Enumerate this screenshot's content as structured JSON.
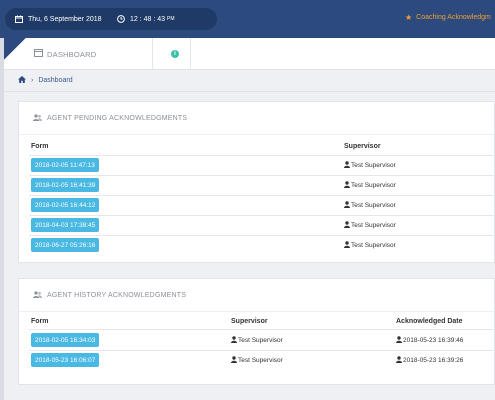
{
  "topbar": {
    "date": "Thu, 6 September 2018",
    "time": "12 : 48 : 43",
    "ampm": "PM",
    "coaching_link": "Coaching Acknowledgm"
  },
  "header": {
    "dashboard_tab": "DASHBOARD",
    "info_icon": "i"
  },
  "breadcrumb": {
    "home_icon": "home-icon",
    "current": "Dashboard"
  },
  "pending": {
    "title": "AGENT PENDING ACKNOWLEDGMENTS",
    "columns": [
      "Form",
      "Supervisor"
    ],
    "rows": [
      {
        "form": "2018-02-05 11:47:13",
        "supervisor": "Test Supervisor"
      },
      {
        "form": "2018-02-05 16:41:39",
        "supervisor": "Test Supervisor"
      },
      {
        "form": "2018-02-05 16:44:12",
        "supervisor": "Test Supervisor"
      },
      {
        "form": "2018-04-03 17:38:45",
        "supervisor": "Test Supervisor"
      },
      {
        "form": "2018-06-27 05:26:16",
        "supervisor": "Test Supervisor"
      }
    ]
  },
  "history": {
    "title": "AGENT HISTORY ACKNOWLEDGMENTS",
    "columns": [
      "Form",
      "Supervisor",
      "Acknowledged Date"
    ],
    "rows": [
      {
        "form": "2018-02-05 16:34:03",
        "supervisor": "Test Supervisor",
        "ack_date": "2018-05-23 16:39:46"
      },
      {
        "form": "2018-05-23 16:06:07",
        "supervisor": "Test Supervisor",
        "ack_date": "2018-05-23 16:39:26"
      }
    ]
  },
  "colors": {
    "topbar": "#2d4a7e",
    "badge": "#49b8e3",
    "accent": "#f0a030"
  }
}
